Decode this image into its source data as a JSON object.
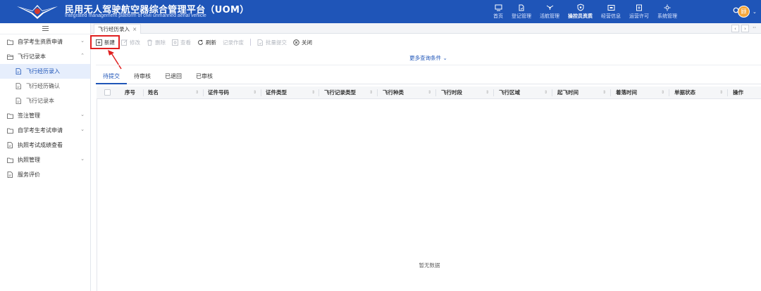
{
  "header": {
    "title": "民用无人驾驶航空器综合管理平台（UOM）",
    "subtitle": "Integrated management platform of civil unmanned aerial vehicle",
    "nav": [
      {
        "label": "首页",
        "icon": "monitor-icon"
      },
      {
        "label": "登记管理",
        "icon": "document-icon"
      },
      {
        "label": "活航管理",
        "icon": "drone-icon"
      },
      {
        "label": "操控员资质",
        "icon": "shield-icon",
        "active": true
      },
      {
        "label": "经营信息",
        "icon": "screen-icon"
      },
      {
        "label": "运营许可",
        "icon": "license-icon"
      },
      {
        "label": "系统管理",
        "icon": "settings-icon"
      }
    ],
    "avatar_text": "顾",
    "brand_color": "#1f55b8"
  },
  "sidebar": {
    "items": [
      {
        "label": "自学考生资质申请",
        "type": "folder",
        "expanded": false
      },
      {
        "label": "飞行记录本",
        "type": "folder",
        "expanded": true
      },
      {
        "label": "飞行经历录入",
        "type": "page",
        "child": true,
        "selected": true
      },
      {
        "label": "飞行经历确认",
        "type": "page",
        "child": true
      },
      {
        "label": "飞行记录本",
        "type": "page",
        "child": true
      },
      {
        "label": "签注管理",
        "type": "folder",
        "expanded": false
      },
      {
        "label": "自学考生考试申请",
        "type": "folder",
        "expanded": false
      },
      {
        "label": "执照考试成绩查看",
        "type": "page"
      },
      {
        "label": "执照管理",
        "type": "folder",
        "expanded": false
      },
      {
        "label": "服务评价",
        "type": "page"
      }
    ]
  },
  "tabs": [
    {
      "label": "飞行经历录入"
    }
  ],
  "toolbar": {
    "new": "新建",
    "edit": "修改",
    "delete": "删除",
    "view": "查看",
    "refresh": "刷新",
    "void": "记录作废",
    "batch_submit": "批量提交",
    "close": "关闭"
  },
  "more_query": "更多查询条件",
  "subtabs": [
    "待提交",
    "待审核",
    "已退回",
    "已审核"
  ],
  "table": {
    "columns": [
      "序号",
      "姓名",
      "证件号码",
      "证件类型",
      "飞行记录类型",
      "飞行种类",
      "飞行时段",
      "飞行区域",
      "起飞时间",
      "着落时间",
      "单据状态",
      "操作"
    ],
    "rows": [],
    "empty_text": "暂无数据"
  }
}
